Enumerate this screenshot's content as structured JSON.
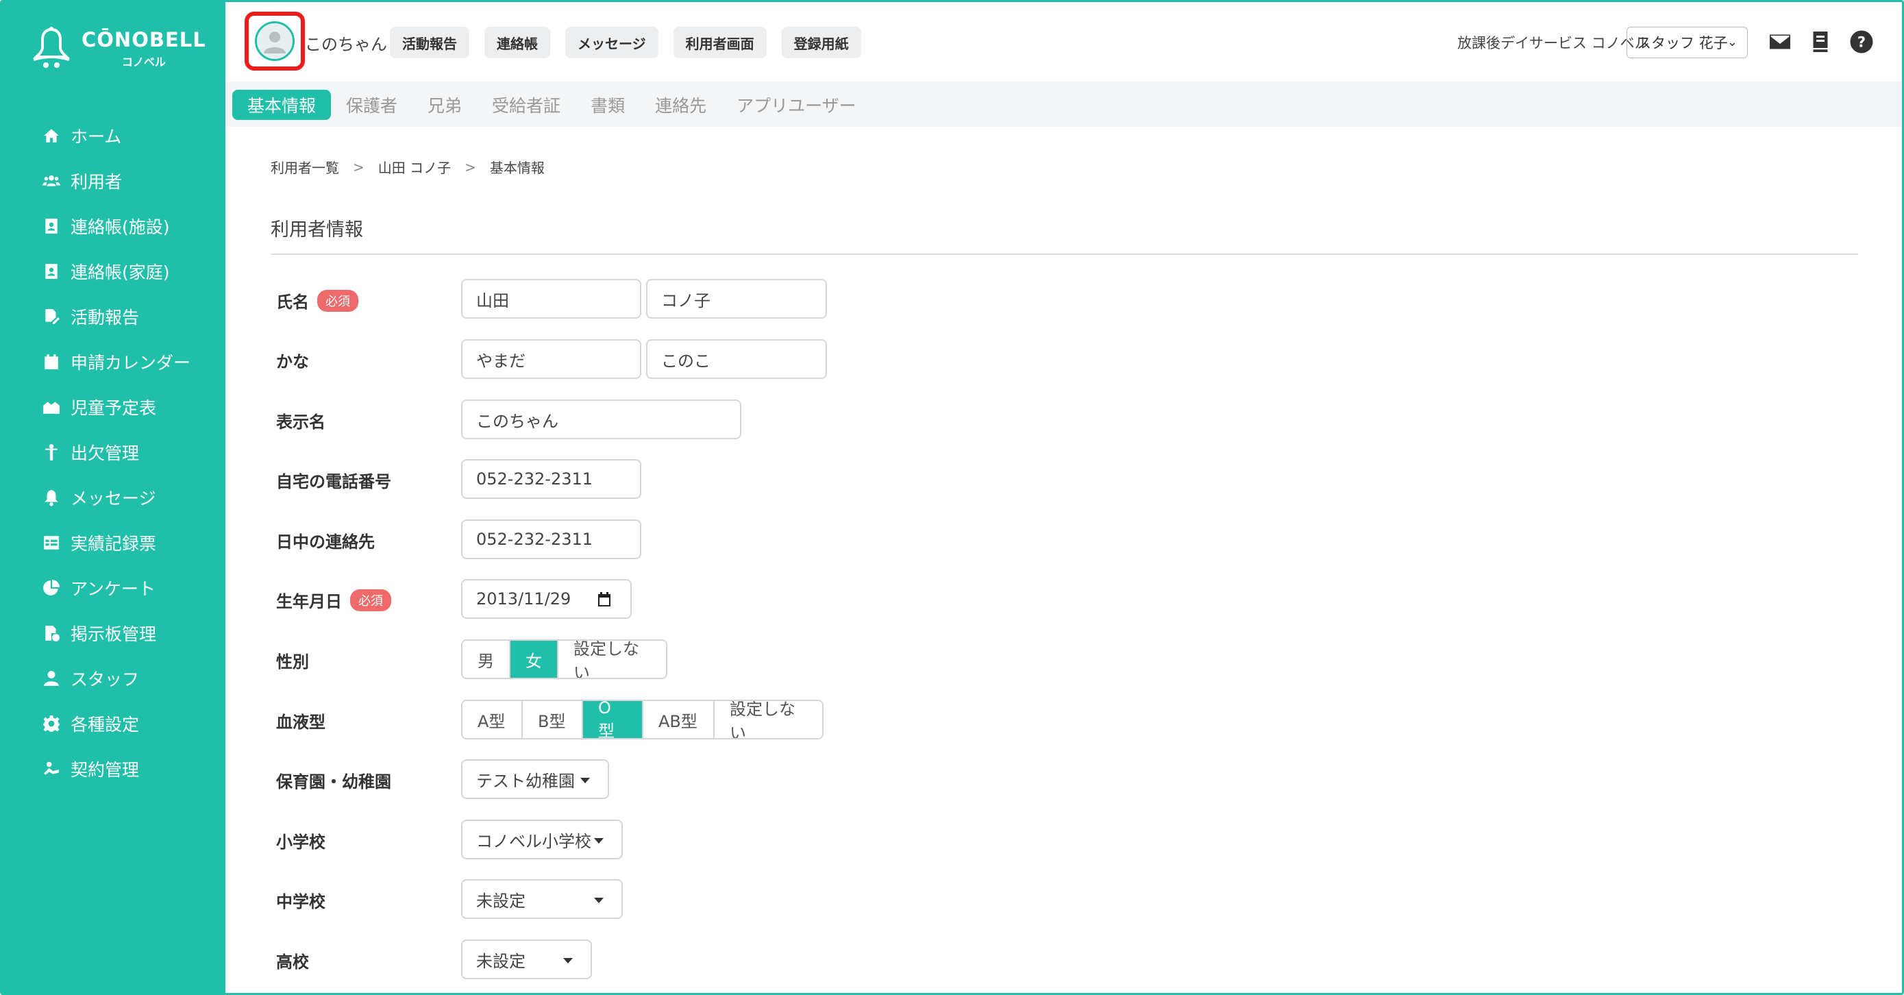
{
  "colors": {
    "accent": "#20bfa9",
    "highlight_border": "#ee1b1b",
    "required_badge": "#ef6a6a"
  },
  "logo": {
    "main": "CŌNOBELL",
    "sub": "コノベル"
  },
  "sidebar": {
    "items": [
      {
        "label": "ホーム",
        "icon": "home-icon"
      },
      {
        "label": "利用者",
        "icon": "users-icon"
      },
      {
        "label": "連絡帳(施設)",
        "icon": "contact-book-icon"
      },
      {
        "label": "連絡帳(家庭)",
        "icon": "contact-book-icon"
      },
      {
        "label": "活動報告",
        "icon": "activity-report-icon"
      },
      {
        "label": "申請カレンダー",
        "icon": "calendar-icon"
      },
      {
        "label": "児童予定表",
        "icon": "schedule-icon"
      },
      {
        "label": "出欠管理",
        "icon": "attendance-icon"
      },
      {
        "label": "メッセージ",
        "icon": "bell-icon"
      },
      {
        "label": "実績記録票",
        "icon": "table-icon"
      },
      {
        "label": "アンケート",
        "icon": "pie-chart-icon"
      },
      {
        "label": "掲示板管理",
        "icon": "bulletin-icon"
      },
      {
        "label": "スタッフ",
        "icon": "staff-icon"
      },
      {
        "label": "各種設定",
        "icon": "gear-icon"
      },
      {
        "label": "契約管理",
        "icon": "contract-icon"
      }
    ]
  },
  "header": {
    "user_name": "このちゃん",
    "buttons": [
      "活動報告",
      "連絡帳",
      "メッセージ",
      "利用者画面",
      "登録用紙"
    ],
    "facility": "放課後デイサービス コノベル",
    "staff_select": "スタッフ 花子"
  },
  "tabs": [
    "基本情報",
    "保護者",
    "兄弟",
    "受給者証",
    "書類",
    "連絡先",
    "アプリユーザー"
  ],
  "breadcrumb": [
    "利用者一覧",
    "山田 コノ子",
    "基本情報"
  ],
  "section_title": "利用者情報",
  "form": {
    "required_label": "必須",
    "name_label": "氏名",
    "name_last": "山田",
    "name_first": "コノ子",
    "kana_label": "かな",
    "kana_last": "やまだ",
    "kana_first": "このこ",
    "display_label": "表示名",
    "display_name": "このちゃん",
    "home_phone_label": "自宅の電話番号",
    "home_phone": "052-232-2311",
    "day_contact_label": "日中の連絡先",
    "day_contact": "052-232-2311",
    "birthday_label": "生年月日",
    "birthday": "2013/11/29",
    "gender_label": "性別",
    "gender_options": [
      "男",
      "女",
      "設定しない"
    ],
    "gender_selected": "女",
    "blood_label": "血液型",
    "blood_options": [
      "A型",
      "B型",
      "O型",
      "AB型",
      "設定しない"
    ],
    "blood_selected": "O型",
    "nursery_label": "保育園・幼稚園",
    "nursery": "テスト幼稚園",
    "elementary_label": "小学校",
    "elementary": "コノベル小学校",
    "junior_label": "中学校",
    "junior": "未設定",
    "high_label": "高校",
    "high": "未設定"
  }
}
